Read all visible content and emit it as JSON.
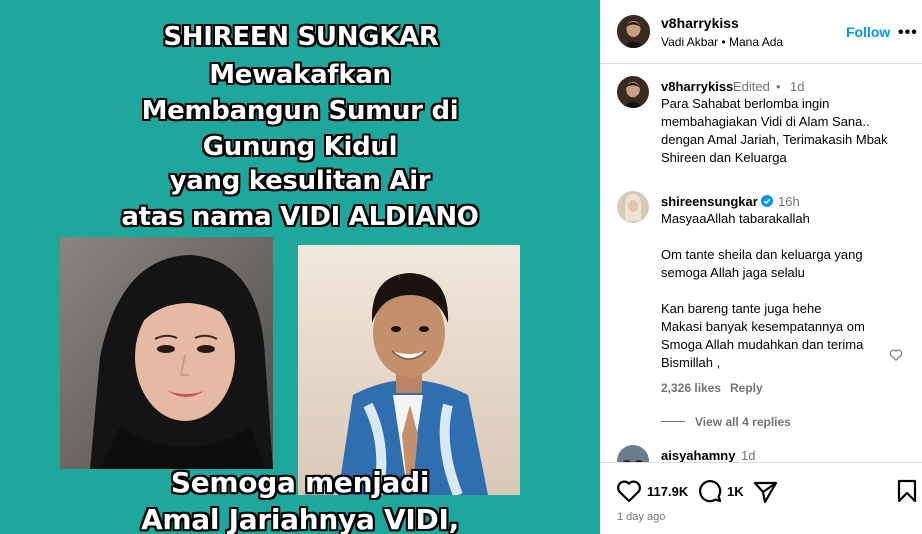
{
  "post_image": {
    "lines": [
      "SHIREEN SUNGKAR",
      "Mewakafkan",
      "Membangun Sumur di",
      "Gunung Kidul",
      "yang kesulitan  Air",
      "atas nama VIDI ALDIANO",
      "Semoga menjadi",
      "Amal Jariahnya  VIDI,"
    ]
  },
  "header": {
    "username": "v8harrykiss",
    "subtitle": "Vadi Akbar • Mana Ada",
    "follow_label": "Follow",
    "more_label": "•••"
  },
  "caption": {
    "username": "v8harrykiss",
    "edited": "Edited",
    "dot": "•",
    "time": "1d",
    "text": "Para Sahabat berlomba ingin membahagiakan Vidi di Alam Sana.. dengan Amal Jariah, Terimakasih Mbak Shireen dan Keluarga"
  },
  "comments": [
    {
      "username": "shireensungkar",
      "verified": true,
      "time": "16h",
      "lines": [
        "MasyaaAllah tabarakallah",
        "",
        "Om tante sheila dan keluarga yang semoga Allah jaga selalu",
        "",
        "Kan bareng tante juga hehe",
        "Makasi banyak kesempatannya om Smoga Allah mudahkan dan terima Bismillah ,"
      ],
      "likes": "2,326 likes",
      "reply_label": "Reply",
      "view_replies": "View all 4 replies"
    },
    {
      "username": "aisyahamny",
      "time": "1d"
    }
  ],
  "actions": {
    "likes_count": "117.9K",
    "comments_count": "1K",
    "timestamp": "1 day ago"
  },
  "colors": {
    "post_bg": "#1ea89d",
    "accent": "#0095f6",
    "muted": "#737373"
  }
}
